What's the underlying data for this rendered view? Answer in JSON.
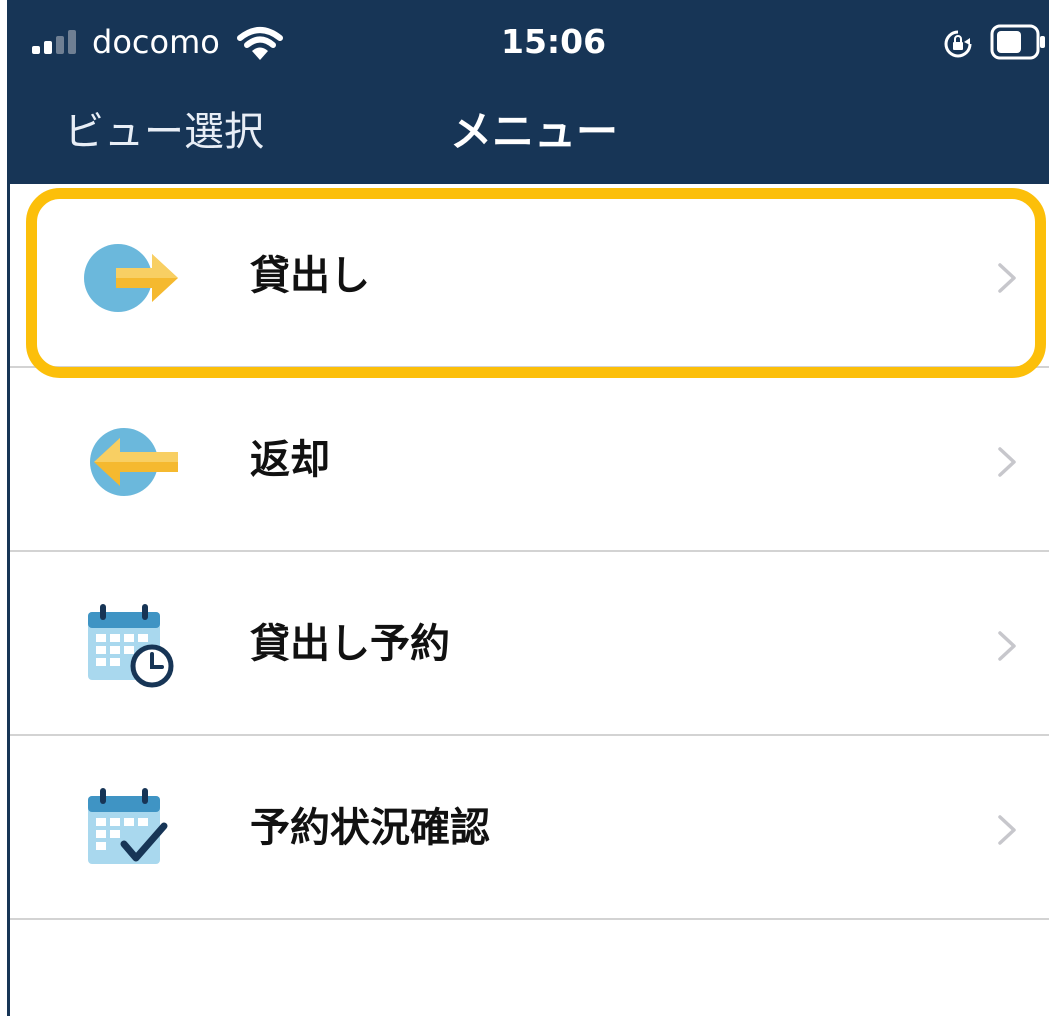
{
  "status_bar": {
    "carrier": "docomo",
    "time": "15:06",
    "icons": [
      "signal-icon",
      "wifi-icon",
      "rotation-lock-icon",
      "battery-icon"
    ]
  },
  "nav": {
    "back_label": "ビュー選択",
    "title": "メニュー"
  },
  "menu": {
    "items": [
      {
        "label": "貸出し",
        "icon": "checkout-arrow-icon",
        "highlighted": true
      },
      {
        "label": "返却",
        "icon": "return-arrow-icon"
      },
      {
        "label": "貸出し予約",
        "icon": "calendar-clock-icon"
      },
      {
        "label": "予約状況確認",
        "icon": "calendar-check-icon"
      }
    ]
  },
  "colors": {
    "header_bg": "#173556",
    "highlight": "#fcbf0a",
    "icon_blue": "#6bb8dc",
    "arrow_yellow": "#f5b92f",
    "chevron": "#c7c7cc"
  }
}
